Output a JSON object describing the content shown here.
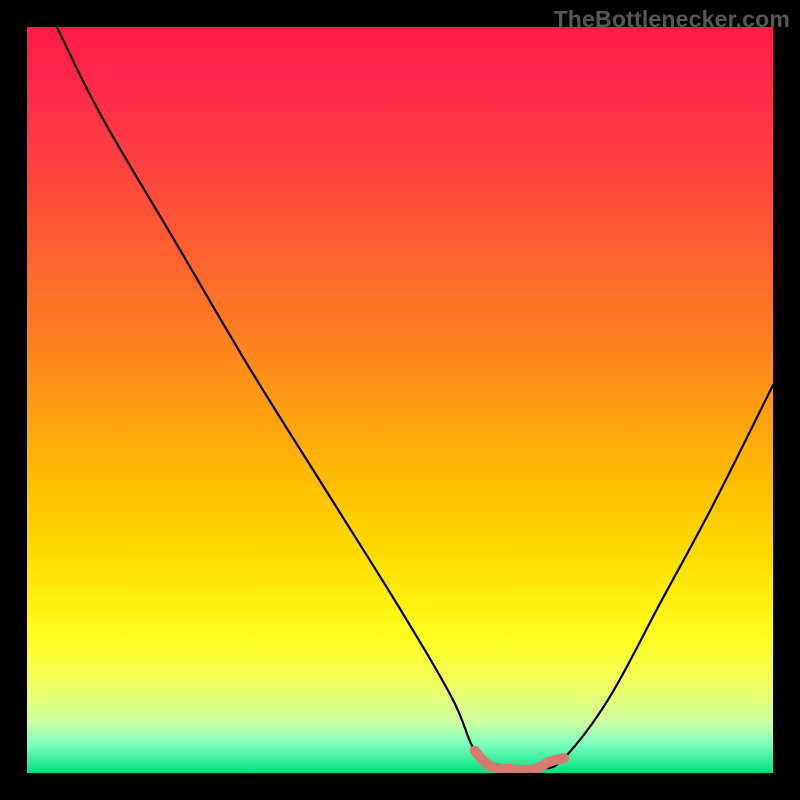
{
  "watermark": "TheBottlenecker.com",
  "chart_data": {
    "type": "line",
    "title": "",
    "xlabel": "",
    "ylabel": "",
    "xlim": [
      0,
      100
    ],
    "ylim": [
      0,
      100
    ],
    "series": [
      {
        "name": "bottleneck-curve",
        "x": [
          4,
          10,
          20,
          30,
          40,
          50,
          57,
          60,
          63,
          66,
          69,
          72,
          78,
          85,
          92,
          100
        ],
        "y": [
          100,
          88,
          71,
          54,
          38,
          22,
          10,
          3,
          0.5,
          0,
          0.5,
          2,
          10,
          23,
          36,
          52
        ],
        "color": "#000000"
      },
      {
        "name": "optimal-zone",
        "x": [
          60,
          62,
          65,
          68,
          70,
          72
        ],
        "y": [
          3,
          1,
          0.5,
          0.5,
          1.5,
          2
        ],
        "color": "#d87a6f"
      }
    ],
    "gradient_stops": [
      {
        "pos": 0,
        "color": "#ff1a4a"
      },
      {
        "pos": 50,
        "color": "#ffc000"
      },
      {
        "pos": 85,
        "color": "#ffff40"
      },
      {
        "pos": 100,
        "color": "#00e080"
      }
    ]
  }
}
